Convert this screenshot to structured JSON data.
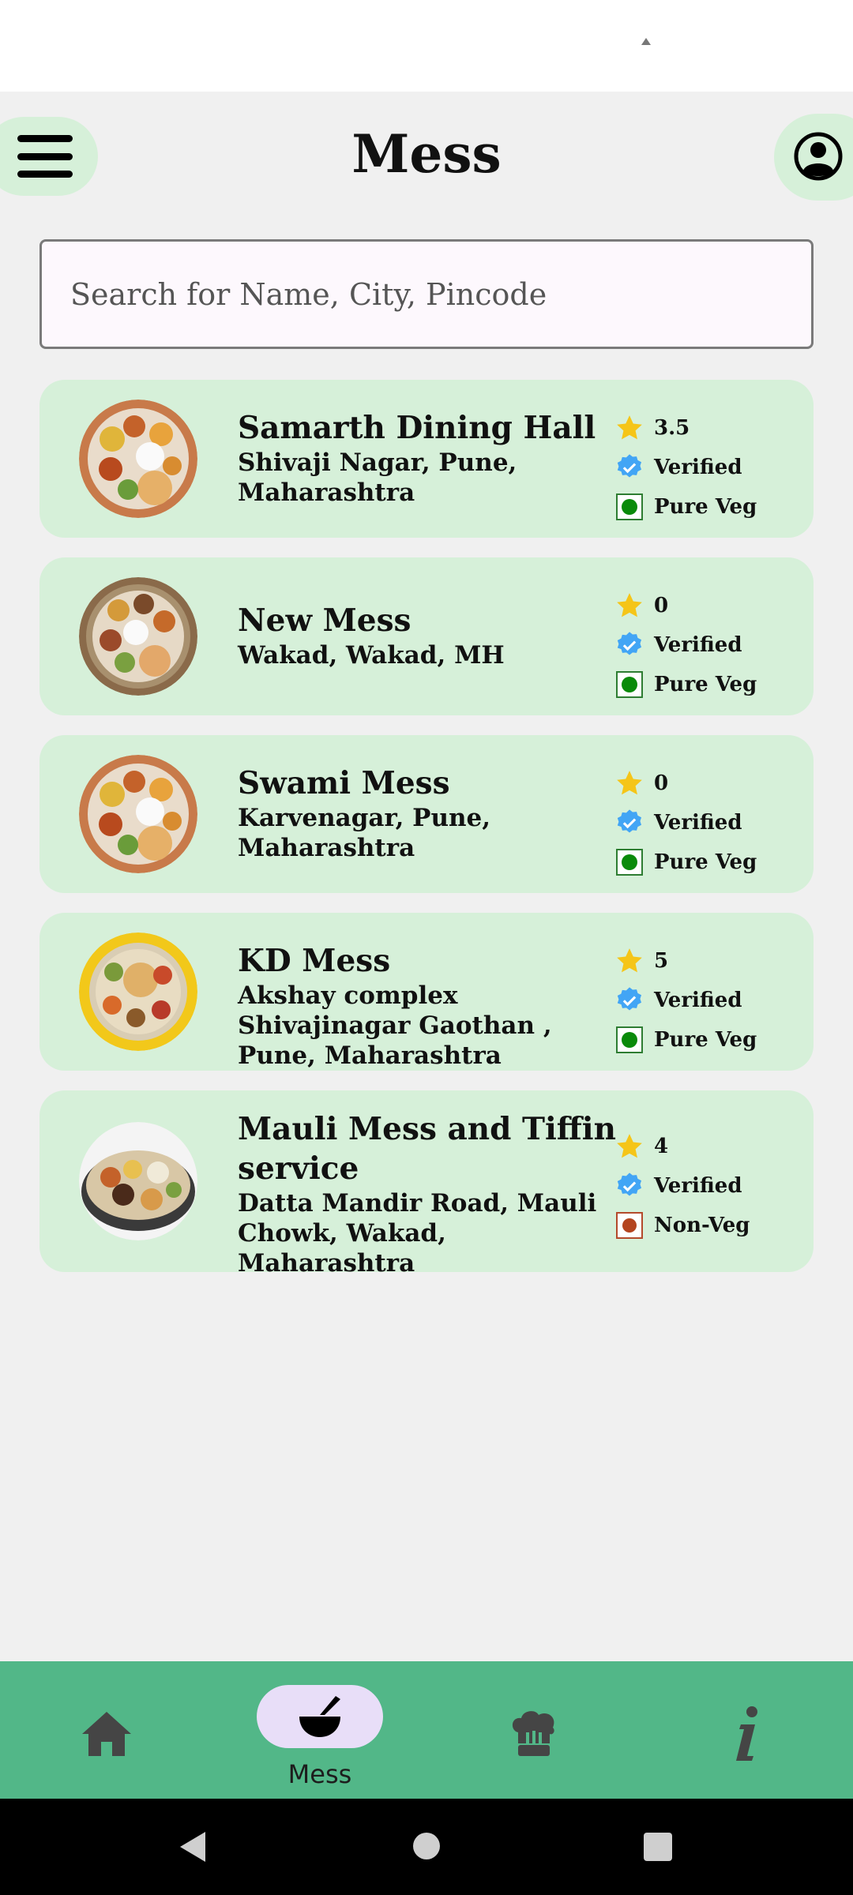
{
  "header": {
    "title": "Mess"
  },
  "search": {
    "placeholder": "Search for Name, City, Pincode"
  },
  "messes": [
    {
      "name": "Samarth Dining Hall",
      "address": "Shivaji Nagar, Pune, Maharashtra",
      "rating": "3.5",
      "verified": "Verified",
      "food_type": "Pure Veg"
    },
    {
      "name": "New Mess",
      "address": "Wakad, Wakad, MH",
      "rating": "0",
      "verified": "Verified",
      "food_type": "Pure Veg"
    },
    {
      "name": "Swami Mess",
      "address": "Karvenagar, Pune, Maharashtra",
      "rating": "0",
      "verified": "Verified",
      "food_type": "Pure Veg"
    },
    {
      "name": "KD Mess",
      "address": "Akshay complex Shivajinagar Gaothan , Pune, Maharashtra",
      "rating": "5",
      "verified": "Verified",
      "food_type": "Pure Veg"
    },
    {
      "name": "Mauli Mess and Tiffin service",
      "address": "Datta Mandir Road, Mauli Chowk, Wakad, Maharashtra",
      "rating": "4",
      "verified": "Verified",
      "food_type": "Non-Veg"
    }
  ],
  "bottom_nav": {
    "items": [
      {
        "icon": "home-icon"
      },
      {
        "icon": "mess-bowl-icon",
        "label": "Mess",
        "active": true
      },
      {
        "icon": "chef-hat-icon"
      },
      {
        "icon": "info-icon"
      }
    ]
  },
  "colors": {
    "card_bg": "#d6f0d9",
    "nav_bg": "#52b788",
    "active_pill": "#e8def8",
    "star": "#f5c518",
    "verified": "#42a5f5",
    "veg": "#0a8a0a",
    "nonveg": "#b4441f"
  }
}
